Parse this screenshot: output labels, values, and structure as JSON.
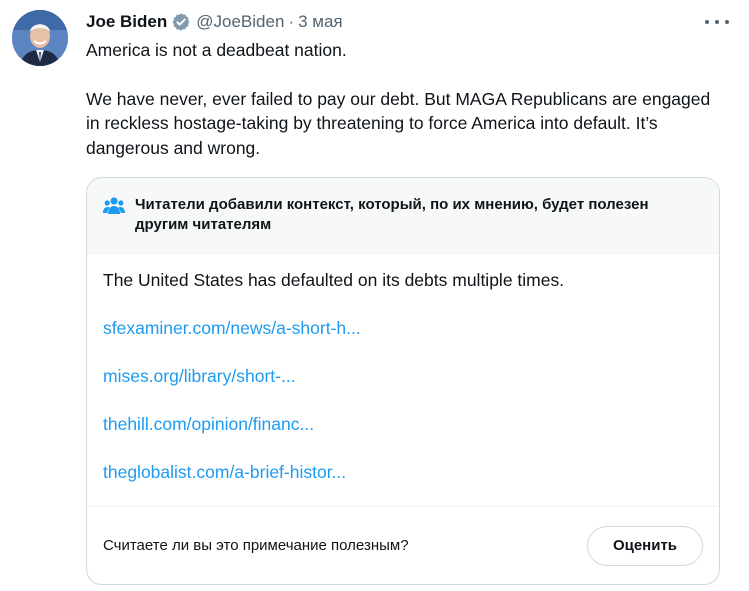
{
  "author": {
    "name": "Joe Biden",
    "handle": "@JoeBiden",
    "separator": "·",
    "date": "3 мая"
  },
  "tweet": {
    "line1": "America is not a deadbeat nation.",
    "line2": "We have never, ever failed to pay our debt. But MAGA Republicans are engaged in reckless hostage-taking by threatening to force America into default. It’s dangerous and wrong."
  },
  "community_note": {
    "title": "Читатели добавили контекст, который, по их мнению, будет полезен другим читателям",
    "text": "The United States has defaulted on its debts multiple times.",
    "links": [
      "sfexaminer.com/news/a-short-h...",
      "mises.org/library/short-...",
      "thehill.com/opinion/financ...",
      "theglobalist.com/a-brief-histor..."
    ],
    "question": "Считаете ли вы это примечание полезным?",
    "rate_label": "Оценить"
  },
  "colors": {
    "link": "#1d9bf0",
    "verified_badge": "#829aab",
    "secondary_text": "#536471",
    "border": "#cfd9de"
  },
  "icons": [
    "avatar",
    "verified-badge-icon",
    "more-options-icon",
    "people-icon"
  ]
}
